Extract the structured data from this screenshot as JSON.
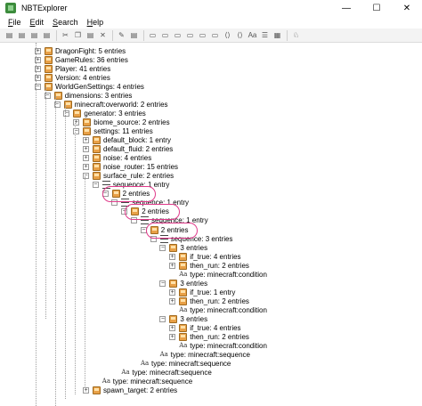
{
  "window": {
    "title": "NBTExplorer",
    "minimize": "—",
    "maximize": "☐",
    "close": "✕"
  },
  "menu": [
    {
      "label_u": "F",
      "label_rest": "ile"
    },
    {
      "label_u": "E",
      "label_rest": "dit"
    },
    {
      "label_u": "S",
      "label_rest": "earch"
    },
    {
      "label_u": "H",
      "label_rest": "elp"
    }
  ],
  "toolbar": {
    "icons": [
      "open-folder-icon",
      "open-icon",
      "save-icon",
      "open-file-icon",
      "cut-icon",
      "copy-icon",
      "paste-icon",
      "delete-icon",
      "rename-icon",
      "edit-icon",
      "byte-icon",
      "short-icon",
      "int-icon",
      "long-icon",
      "float-icon",
      "double-icon",
      "byte-array-icon",
      "int-array-icon",
      "string-icon",
      "list-icon",
      "compound-icon",
      "search-icon"
    ],
    "glyphs": [
      "▤",
      "▤",
      "▤",
      "▤",
      "✂",
      "❐",
      "▤",
      "✕",
      "✎",
      "▤",
      "▭",
      "▭",
      "▭",
      "▭",
      "▭",
      "▭",
      "⟨⟩",
      "⟨⟩",
      "Aa",
      "☰",
      "▦",
      "♘"
    ]
  },
  "tree": {
    "nodes": [
      {
        "label": "DragonFight: 5 entries",
        "icon": "compound",
        "expander": "+"
      },
      {
        "label": "GameRules: 36 entries",
        "icon": "compound",
        "expander": "+"
      },
      {
        "label": "Player: 41 entries",
        "icon": "compound",
        "expander": "+"
      },
      {
        "label": "Version: 4 entries",
        "icon": "compound",
        "expander": "+"
      },
      {
        "label": "WorldGenSettings: 4 entries",
        "icon": "compound",
        "expander": "−"
      },
      {
        "label": "dimensions: 3 entries",
        "icon": "compound",
        "expander": "−"
      },
      {
        "label": "minecraft:overworld: 2 entries",
        "icon": "compound",
        "expander": "−"
      },
      {
        "label": "generator: 3 entries",
        "icon": "compound",
        "expander": "−"
      },
      {
        "label": "biome_source: 2 entries",
        "icon": "compound",
        "expander": "+"
      },
      {
        "label": "settings: 11 entries",
        "icon": "compound",
        "expander": "−"
      },
      {
        "label": "default_block: 1 entry",
        "icon": "compound",
        "expander": "+"
      },
      {
        "label": "default_fluid: 2 entries",
        "icon": "compound",
        "expander": "+"
      },
      {
        "label": "noise: 4 entries",
        "icon": "compound",
        "expander": "+"
      },
      {
        "label": "noise_router: 15 entries",
        "icon": "compound",
        "expander": "+"
      },
      {
        "label": "surface_rule: 2 entries",
        "icon": "compound",
        "expander": "−"
      },
      {
        "label": "sequence: 1 entry",
        "icon": "list",
        "expander": "−"
      },
      {
        "label": "2 entries",
        "icon": "compound",
        "expander": "−"
      },
      {
        "label": "sequence: 1 entry",
        "icon": "list",
        "expander": "−"
      },
      {
        "label": "2 entries",
        "icon": "compound",
        "expander": "−"
      },
      {
        "label": "sequence: 1 entry",
        "icon": "list",
        "expander": "−"
      },
      {
        "label": "2 entries",
        "icon": "compound",
        "expander": "−"
      },
      {
        "label": "sequence: 3 entries",
        "icon": "list",
        "expander": "−"
      },
      {
        "label": "3 entries",
        "icon": "compound",
        "expander": "−"
      },
      {
        "label": "if_true: 4 entries",
        "icon": "compound",
        "expander": "+"
      },
      {
        "label": "then_run: 2 entries",
        "icon": "compound",
        "expander": "+"
      },
      {
        "label": "type: minecraft:condition",
        "icon": "string",
        "expander": ""
      },
      {
        "label": "3 entries",
        "icon": "compound",
        "expander": "−"
      },
      {
        "label": "if_true: 1 entry",
        "icon": "compound",
        "expander": "+"
      },
      {
        "label": "then_run: 2 entries",
        "icon": "compound",
        "expander": "+"
      },
      {
        "label": "type: minecraft:condition",
        "icon": "string",
        "expander": ""
      },
      {
        "label": "3 entries",
        "icon": "compound",
        "expander": "−"
      },
      {
        "label": "if_true: 4 entries",
        "icon": "compound",
        "expander": "+"
      },
      {
        "label": "then_run: 2 entries",
        "icon": "compound",
        "expander": "+"
      },
      {
        "label": "type: minecraft:condition",
        "icon": "string",
        "expander": ""
      },
      {
        "label": "type: minecraft:sequence",
        "icon": "string",
        "expander": ""
      },
      {
        "label": "type: minecraft:sequence",
        "icon": "string",
        "expander": ""
      },
      {
        "label": "type: minecraft:sequence",
        "icon": "string",
        "expander": ""
      },
      {
        "label": "type: minecraft:sequence",
        "icon": "string",
        "expander": ""
      },
      {
        "label": "spawn_target: 2 entries",
        "icon": "compound",
        "expander": "+"
      }
    ]
  }
}
